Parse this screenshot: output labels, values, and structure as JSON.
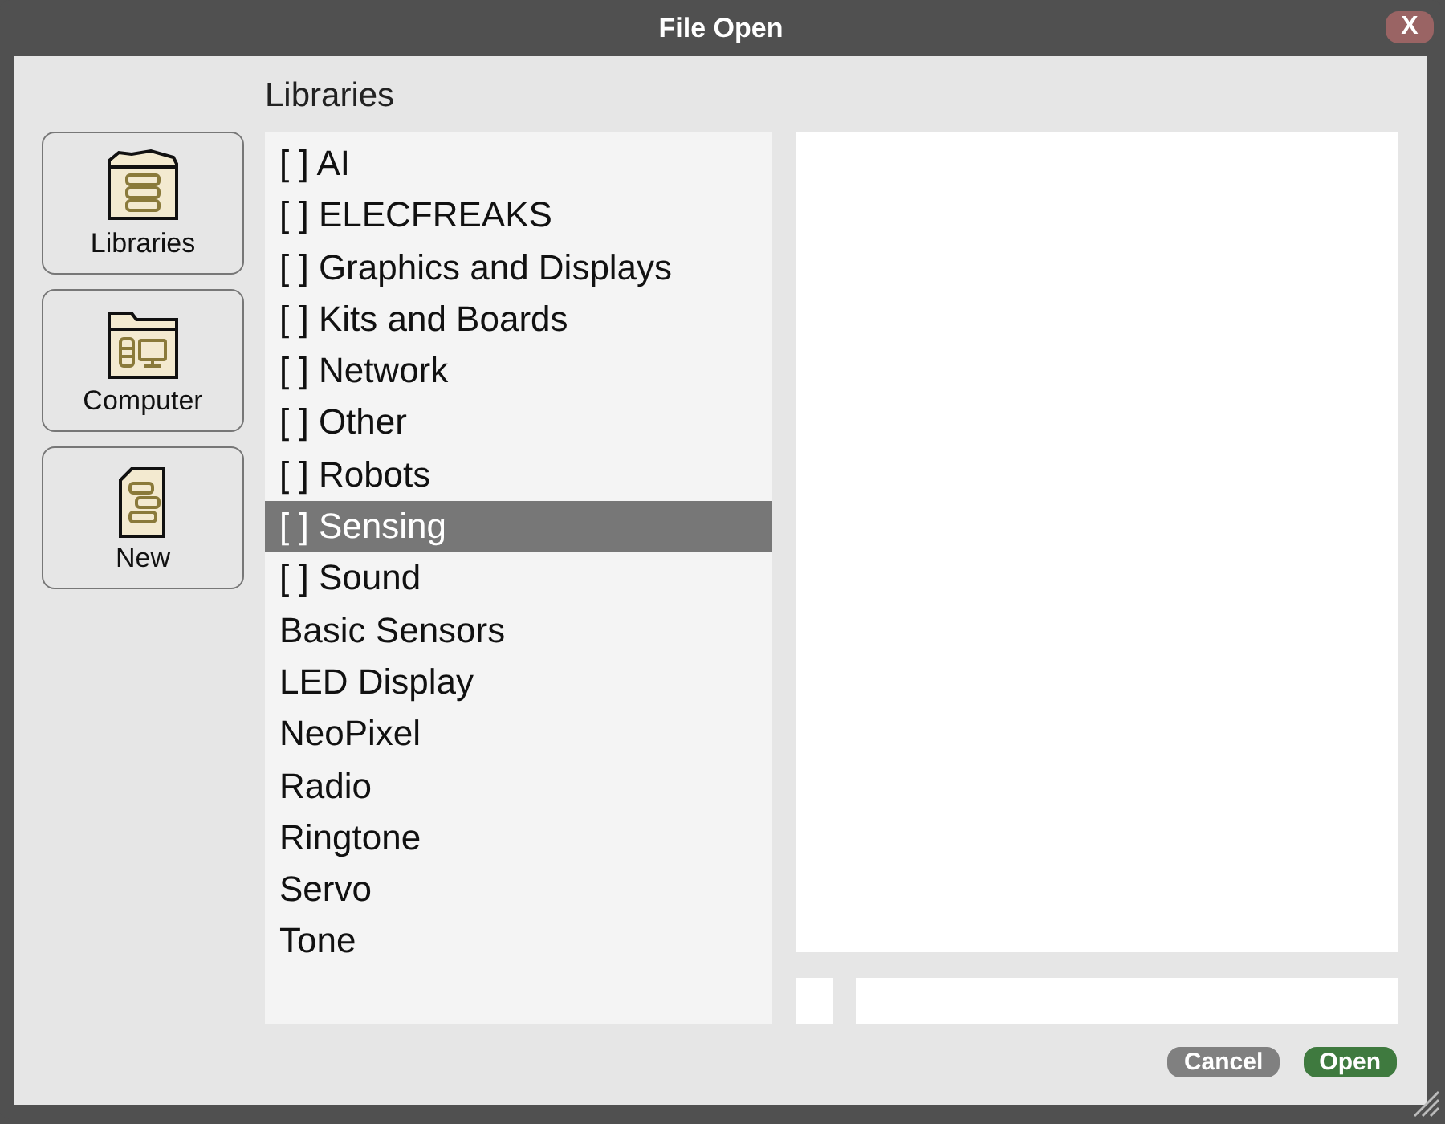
{
  "window": {
    "title": "File Open",
    "close": "X"
  },
  "sidebar": {
    "buttons": [
      {
        "label": "Libraries",
        "kind": "libraries"
      },
      {
        "label": "Computer",
        "kind": "computer"
      },
      {
        "label": "New",
        "kind": "new"
      }
    ]
  },
  "list": {
    "heading": "Libraries",
    "items": [
      {
        "label": "[ ] AI",
        "selected": false
      },
      {
        "label": "[ ] ELECFREAKS",
        "selected": false
      },
      {
        "label": "[ ] Graphics and Displays",
        "selected": false
      },
      {
        "label": "[ ] Kits and Boards",
        "selected": false
      },
      {
        "label": "[ ] Network",
        "selected": false
      },
      {
        "label": "[ ] Other",
        "selected": false
      },
      {
        "label": "[ ] Robots",
        "selected": false
      },
      {
        "label": "[ ] Sensing",
        "selected": true
      },
      {
        "label": "[ ] Sound",
        "selected": false
      },
      {
        "label": "Basic Sensors",
        "selected": false
      },
      {
        "label": "LED Display",
        "selected": false
      },
      {
        "label": "NeoPixel",
        "selected": false
      },
      {
        "label": "Radio",
        "selected": false
      },
      {
        "label": "Ringtone",
        "selected": false
      },
      {
        "label": "Servo",
        "selected": false
      },
      {
        "label": "Tone",
        "selected": false
      }
    ]
  },
  "buttons": [
    {
      "label": "Cancel",
      "kind": "cancel"
    },
    {
      "label": "Open",
      "kind": "open"
    }
  ]
}
